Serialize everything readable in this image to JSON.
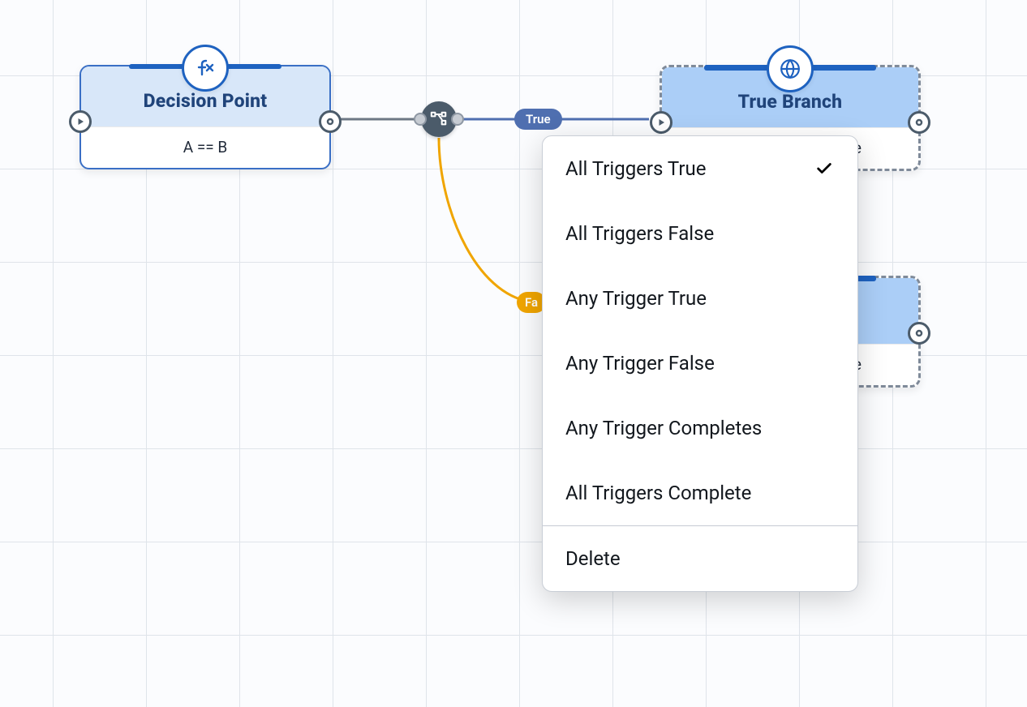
{
  "nodes": {
    "decision": {
      "title": "Decision Point",
      "body": "A == B"
    },
    "true_branch": {
      "title": "True Branch",
      "body_partial": "e"
    },
    "false_branch": {
      "title": "",
      "body_partial": "e"
    }
  },
  "edge_labels": {
    "true": "True",
    "false": "Fa"
  },
  "context_menu": {
    "items": [
      {
        "label": "All Triggers True",
        "checked": true
      },
      {
        "label": "All Triggers False",
        "checked": false
      },
      {
        "label": "Any Trigger True",
        "checked": false
      },
      {
        "label": "Any Trigger False",
        "checked": false
      },
      {
        "label": "Any Trigger Completes",
        "checked": false
      },
      {
        "label": "All Triggers Complete",
        "checked": false
      }
    ],
    "footer": "Delete"
  }
}
